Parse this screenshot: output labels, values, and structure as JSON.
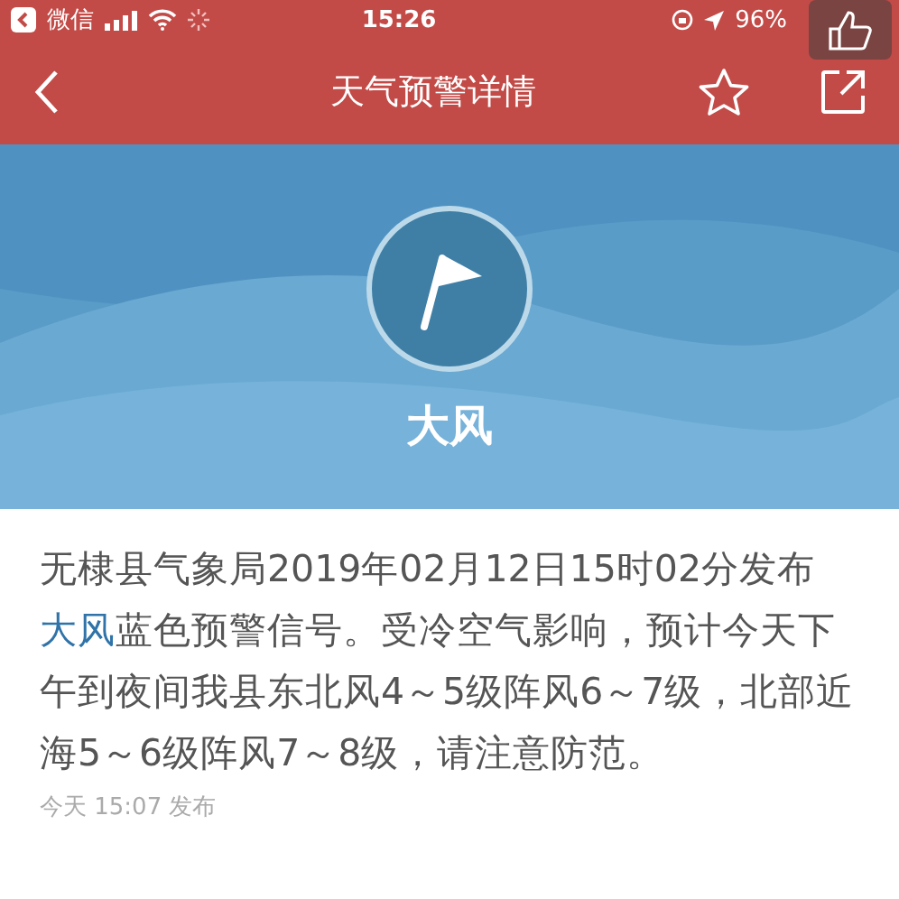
{
  "status_bar": {
    "back_app": "微信",
    "time": "15:26",
    "battery": "96%"
  },
  "nav_bar": {
    "title": "天气预警详情"
  },
  "warning": {
    "name": "大风"
  },
  "description": {
    "segments": [
      {
        "kind": "plain",
        "text": "无棣县气象局2019年02月12日15时02分发布"
      },
      {
        "kind": "link",
        "text": "大风"
      },
      {
        "kind": "plain",
        "text": "蓝色预警信号。受冷空气影响，预计今天下午到夜间我县东北风4～5级阵风6～7级，北部近海5～6级阵风7～8级，请注意防范。"
      }
    ]
  },
  "published": "今天 15:07 发布"
}
